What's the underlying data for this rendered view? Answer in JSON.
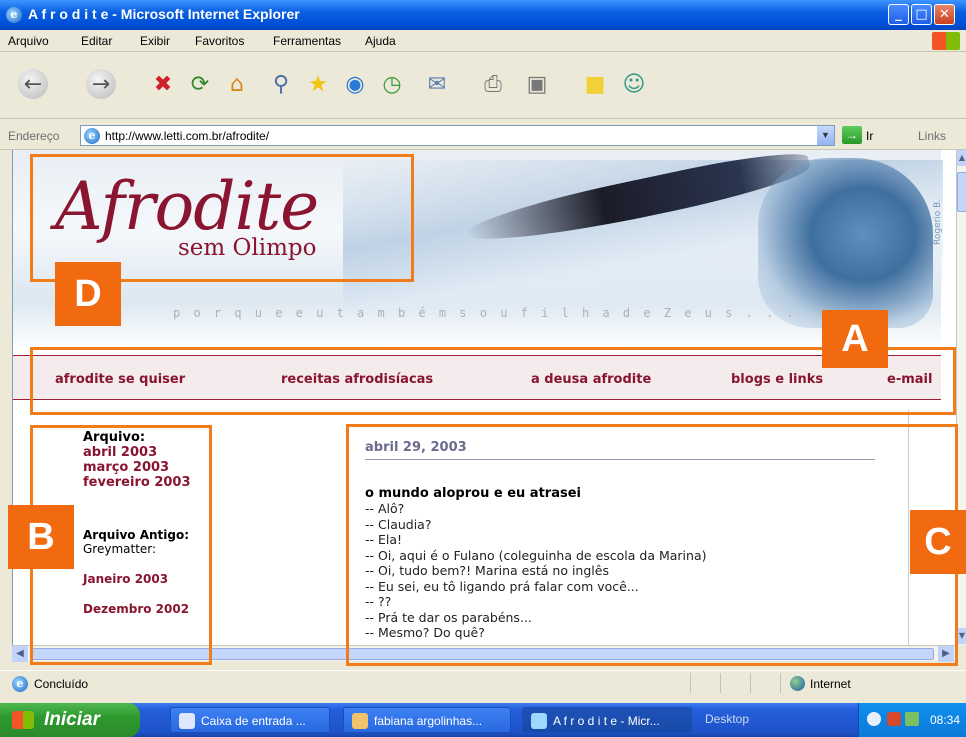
{
  "window": {
    "title": "A f r o d i t e - Microsoft Internet Explorer"
  },
  "menu": [
    "Arquivo",
    "Editar",
    "Exibir",
    "Favoritos",
    "Ferramentas",
    "Ajuda"
  ],
  "address": {
    "label": "Endereço",
    "url": "http://www.letti.com.br/afrodite/",
    "go": "Ir",
    "links": "Links"
  },
  "site": {
    "logo_title": "Afrodite",
    "logo_subtitle": "sem Olimpo",
    "tagline": "p o r q u e  e u  t a m b é m  s o u  f i l h a  d e  Z e u s . . .",
    "credit": "Rogerio B.",
    "nav": [
      "afrodite se quiser",
      "receitas afrodisíacas",
      "a deusa afrodite",
      "blogs e links",
      "e-mail"
    ]
  },
  "sidebar": {
    "archive_heading": "Arquivo:",
    "archive_links": [
      "abril 2003",
      "março 2003",
      "fevereiro 2003"
    ],
    "old_heading": "Arquivo Antigo:",
    "old_sub": "Greymatter:",
    "old_links": [
      "Janeiro 2003",
      "Dezembro 2002"
    ]
  },
  "post": {
    "date": "abril 29, 2003",
    "title": "o mundo aloprou e eu atrasei",
    "lines": [
      "-- Alô?",
      "-- Claudia?",
      "-- Ela!",
      "-- Oi, aqui é o Fulano (coleguinha de escola da Marina)",
      "-- Oi, tudo bem?! Marina está no inglês",
      "-- Eu sei, eu tô ligando prá falar com você...",
      "-- ??",
      "-- Prá te dar os parabéns...",
      "-- Mesmo? Do quê?"
    ]
  },
  "status": {
    "text": "Concluído",
    "zone": "Internet"
  },
  "taskbar": {
    "start": "Iniciar",
    "tasks": [
      "Caixa de entrada ...",
      "fabiana argolinhas...",
      "A f r o d i t e - Micr..."
    ],
    "desktop": "Desktop",
    "time": "08:34"
  },
  "annotations": {
    "A": "A",
    "B": "B",
    "C": "C",
    "D": "D"
  },
  "colors": {
    "accent": "#8a1530",
    "annotation": "#f26a10"
  }
}
